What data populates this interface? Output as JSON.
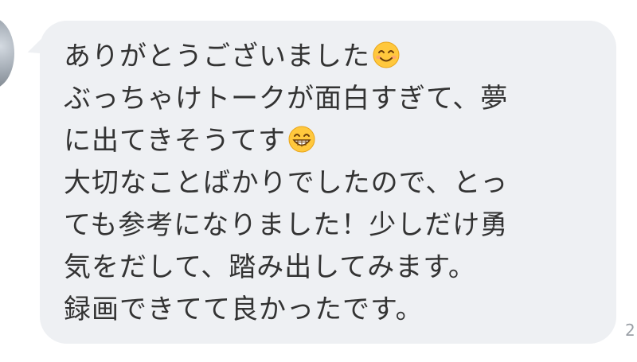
{
  "message": {
    "lines": [
      {
        "text": "ありがとうございました",
        "emoji": "smiling-face-icon"
      },
      {
        "text": "ぶっちゃけトークが面白すぎて、夢"
      },
      {
        "text": "に出てきそうてす",
        "emoji": "grinning-face-icon"
      },
      {
        "text": "大切なことばかりでしたので、とっ"
      },
      {
        "text": "ても参考になりました！少しだけ勇"
      },
      {
        "text": "気をだして、踏み出してみます。"
      },
      {
        "text": "録画できてて良かったです。"
      }
    ]
  },
  "timestamp": "2",
  "colors": {
    "bubble": "#eef0f3",
    "text": "#333333",
    "emoji_face": "#ffc83d"
  }
}
